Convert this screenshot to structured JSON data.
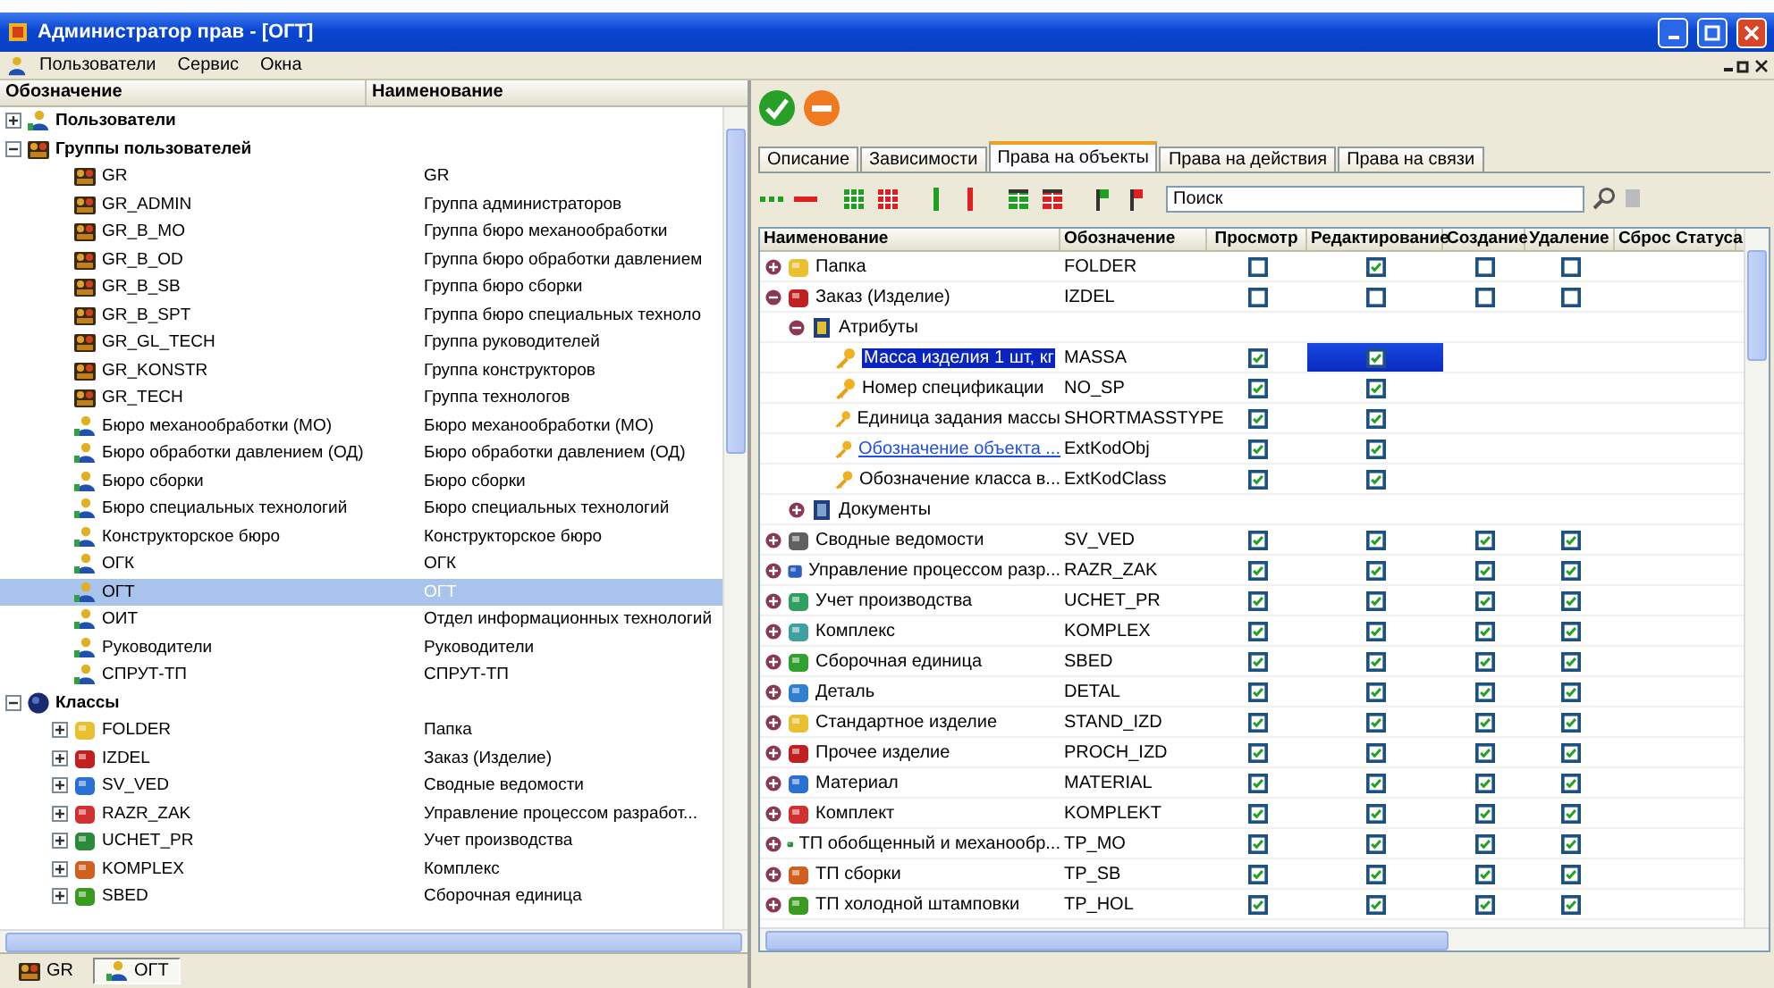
{
  "window": {
    "title": "Администратор прав - [ОГТ]"
  },
  "menu": [
    "Пользователи",
    "Сервис",
    "Окна"
  ],
  "left_tree": {
    "columns": [
      "Обозначение",
      "Наименование"
    ],
    "items": [
      {
        "code": "Пользователи",
        "kind": "users-root",
        "expanded": false,
        "selected": false
      },
      {
        "code": "Группы пользователей",
        "kind": "groups-root",
        "expanded": true,
        "selected": false,
        "children": [
          {
            "code": "GR",
            "name": "GR",
            "kind": "group",
            "selected": false
          },
          {
            "code": "GR_ADMIN",
            "name": "Группа администраторов",
            "kind": "group",
            "selected": false
          },
          {
            "code": "GR_B_MO",
            "name": "Группа бюро механообработки",
            "kind": "group",
            "selected": false
          },
          {
            "code": "GR_B_OD",
            "name": "Группа бюро обработки давлением",
            "kind": "group",
            "selected": false
          },
          {
            "code": "GR_B_SB",
            "name": "Группа бюро сборки",
            "kind": "group",
            "selected": false
          },
          {
            "code": "GR_B_SPT",
            "name": "Группа бюро специальных техноло",
            "kind": "group",
            "selected": false
          },
          {
            "code": "GR_GL_TECH",
            "name": "Группа руководителей",
            "kind": "group",
            "selected": false
          },
          {
            "code": "GR_KONSTR",
            "name": "Группа конструкторов",
            "kind": "group",
            "selected": false
          },
          {
            "code": "GR_TECH",
            "name": "Группа технологов",
            "kind": "group",
            "selected": false
          },
          {
            "code": "Бюро механообработки (МО)",
            "name": "Бюро механообработки (МО)",
            "kind": "user",
            "selected": false
          },
          {
            "code": "Бюро обработки давлением (ОД)",
            "name": "Бюро обработки давлением (ОД)",
            "kind": "user",
            "selected": false
          },
          {
            "code": "Бюро сборки",
            "name": "Бюро сборки",
            "kind": "user",
            "selected": false
          },
          {
            "code": "Бюро специальных технологий",
            "name": "Бюро специальных технологий",
            "kind": "user",
            "selected": false
          },
          {
            "code": "Конструкторское бюро",
            "name": "Конструкторское бюро",
            "kind": "user",
            "selected": false
          },
          {
            "code": "ОГК",
            "name": "ОГК",
            "kind": "user",
            "selected": false
          },
          {
            "code": "ОГТ",
            "name": "ОГТ",
            "kind": "user",
            "selected": true
          },
          {
            "code": "ОИТ",
            "name": "Отдел информационных технологий",
            "kind": "user",
            "selected": false
          },
          {
            "code": "Руководители",
            "name": "Руководители",
            "kind": "user",
            "selected": false
          },
          {
            "code": "СПРУТ-ТП",
            "name": "СПРУТ-ТП",
            "kind": "user",
            "selected": false
          }
        ]
      },
      {
        "code": "Классы",
        "kind": "classes-root",
        "expanded": true,
        "selected": false,
        "children": [
          {
            "code": "FOLDER",
            "name": "Папка",
            "kind": "class",
            "expanded": false,
            "selected": false
          },
          {
            "code": "IZDEL",
            "name": "Заказ (Изделие)",
            "kind": "class",
            "expanded": false,
            "selected": false
          },
          {
            "code": "SV_VED",
            "name": "Сводные ведомости",
            "kind": "class",
            "expanded": false,
            "selected": false
          },
          {
            "code": "RAZR_ZAK",
            "name": "Управление процессом разработ...",
            "kind": "class",
            "expanded": false,
            "selected": false
          },
          {
            "code": "UCHET_PR",
            "name": "Учет производства",
            "kind": "class",
            "expanded": false,
            "selected": false
          },
          {
            "code": "KOMPLEX",
            "name": "Комплекс",
            "kind": "class",
            "expanded": false,
            "selected": false
          },
          {
            "code": "SBED",
            "name": "Сборочная единица",
            "kind": "class",
            "expanded": false,
            "selected": false
          }
        ]
      }
    ]
  },
  "left_tabs": [
    {
      "label": "GR",
      "kind": "group",
      "selected": false
    },
    {
      "label": "ОГТ",
      "kind": "user",
      "selected": true
    }
  ],
  "right": {
    "tabs": [
      {
        "label": "Описание",
        "selected": false
      },
      {
        "label": "Зависимости",
        "selected": false
      },
      {
        "label": "Права на объекты",
        "selected": true
      },
      {
        "label": "Права на действия",
        "selected": false
      },
      {
        "label": "Права на связи",
        "selected": false
      }
    ],
    "search": {
      "placeholder": "Поиск"
    },
    "table": {
      "columns": [
        "Наименование",
        "Обозначение",
        "Просмотр",
        "Редактирование",
        "Создание",
        "Удаление",
        "Сброс Статуса"
      ],
      "rows": [
        {
          "name": "Папка",
          "code": "FOLDER",
          "kind": "class",
          "expanded": false,
          "checks": {
            "view": false,
            "edit": true,
            "create": false,
            "delete": false
          }
        },
        {
          "name": "Заказ (Изделие)",
          "code": "IZDEL",
          "kind": "class",
          "expanded": true,
          "checks": {
            "view": false,
            "edit": false,
            "create": false,
            "delete": false
          },
          "children": [
            {
              "name": "Атрибуты",
              "kind": "attributes",
              "expanded": true,
              "children": [
                {
                  "name": "Масса изделия 1 шт, кг",
                  "code": "MASSA",
                  "kind": "attribute",
                  "selected": true,
                  "selected_cells": {
                    "edit": true
                  },
                  "checks": {
                    "view": true,
                    "edit": true
                  }
                },
                {
                  "name": "Номер спецификации",
                  "code": "NO_SP",
                  "kind": "attribute",
                  "selected": false,
                  "checks": {
                    "view": true,
                    "edit": true
                  }
                },
                {
                  "name": "Единица задания массы",
                  "code": "SHORTMASSTYPE",
                  "kind": "attribute",
                  "selected": false,
                  "checks": {
                    "view": true,
                    "edit": true
                  }
                },
                {
                  "name": "Обозначение объекта ...",
                  "code": "ExtKodObj",
                  "kind": "attribute",
                  "selected": false,
                  "hovered": true,
                  "checks": {
                    "view": true,
                    "edit": true
                  }
                },
                {
                  "name": "Обозначение класса в...",
                  "code": "ExtKodClass",
                  "kind": "attribute",
                  "selected": false,
                  "checks": {
                    "view": true,
                    "edit": true
                  }
                }
              ]
            },
            {
              "name": "Документы",
              "kind": "documents",
              "expanded": false
            }
          ]
        },
        {
          "name": "Сводные ведомости",
          "code": "SV_VED",
          "kind": "class",
          "expanded": false,
          "checks": {
            "view": true,
            "edit": true,
            "create": true,
            "delete": true
          }
        },
        {
          "name": "Управление процессом разр...",
          "code": "RAZR_ZAK",
          "kind": "class",
          "expanded": false,
          "checks": {
            "view": true,
            "edit": true,
            "create": true,
            "delete": true
          }
        },
        {
          "name": "Учет производства",
          "code": "UCHET_PR",
          "kind": "class",
          "expanded": false,
          "checks": {
            "view": true,
            "edit": true,
            "create": true,
            "delete": true
          }
        },
        {
          "name": "Комплекс",
          "code": "KOMPLEX",
          "kind": "class",
          "expanded": false,
          "checks": {
            "view": true,
            "edit": true,
            "create": true,
            "delete": true
          }
        },
        {
          "name": "Сборочная единица",
          "code": "SBED",
          "kind": "class",
          "expanded": false,
          "checks": {
            "view": true,
            "edit": true,
            "create": true,
            "delete": true
          }
        },
        {
          "name": "Деталь",
          "code": "DETAL",
          "kind": "class",
          "expanded": false,
          "checks": {
            "view": true,
            "edit": true,
            "create": true,
            "delete": true
          }
        },
        {
          "name": "Стандартное изделие",
          "code": "STAND_IZD",
          "kind": "class",
          "expanded": false,
          "checks": {
            "view": true,
            "edit": true,
            "create": true,
            "delete": true
          }
        },
        {
          "name": "Прочее изделие",
          "code": "PROCH_IZD",
          "kind": "class",
          "expanded": false,
          "checks": {
            "view": true,
            "edit": true,
            "create": true,
            "delete": true
          }
        },
        {
          "name": "Материал",
          "code": "MATERIAL",
          "kind": "class",
          "expanded": false,
          "checks": {
            "view": true,
            "edit": true,
            "create": true,
            "delete": true
          }
        },
        {
          "name": "Комплект",
          "code": "KOMPLEKT",
          "kind": "class",
          "expanded": false,
          "checks": {
            "view": true,
            "edit": true,
            "create": true,
            "delete": true
          }
        },
        {
          "name": "ТП обобщенный и механообр...",
          "code": "TP_MO",
          "kind": "class",
          "expanded": false,
          "checks": {
            "view": true,
            "edit": true,
            "create": true,
            "delete": true
          }
        },
        {
          "name": "ТП сборки",
          "code": "TP_SB",
          "kind": "class",
          "expanded": false,
          "checks": {
            "view": true,
            "edit": true,
            "create": true,
            "delete": true
          }
        },
        {
          "name": "ТП холодной штамповки",
          "code": "TP_HOL",
          "kind": "class",
          "expanded": false,
          "checks": {
            "view": true,
            "edit": true,
            "create": true,
            "delete": true
          }
        }
      ]
    }
  }
}
